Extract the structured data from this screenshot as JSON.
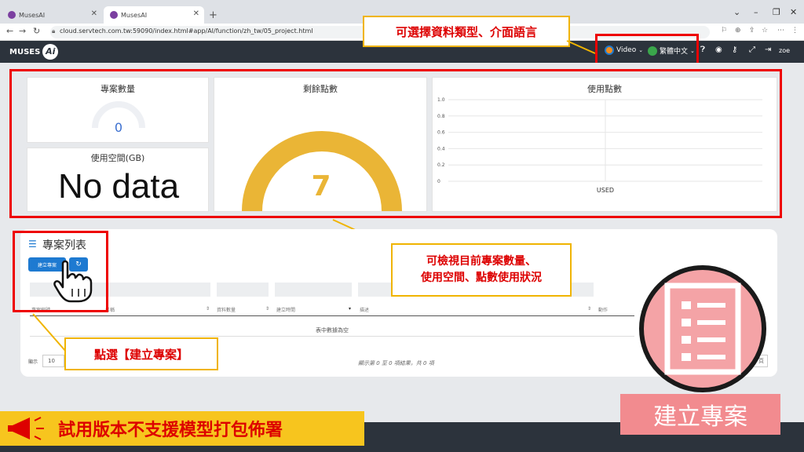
{
  "browser": {
    "tabs": [
      {
        "title": "MusesAI",
        "active": false
      },
      {
        "title": "MusesAI",
        "active": true
      }
    ],
    "url": "cloud.servtech.com.tw:59090/index.html#app/AI/function/zh_tw/05_project.html"
  },
  "header": {
    "logo_text": "MUSES",
    "logo_ai": "Ai",
    "video_label": "Video",
    "lang_label": "繁體中文",
    "user": "zoe"
  },
  "callouts": {
    "data_type_lang": "可選擇資料類型、介面語言",
    "view_stats_line1": "可檢視目前專案數量、",
    "view_stats_line2": "使用空間、點數使用狀況",
    "click_create": "點選【建立專案】"
  },
  "dashboard": {
    "project_count_title": "專案數量",
    "project_count_value": "0",
    "storage_title": "使用空間(GB)",
    "storage_value": "No data",
    "remaining_points_title": "剩餘點數",
    "remaining_points_value": "7",
    "used_points_title": "使用點數"
  },
  "chart_data": {
    "type": "bar",
    "title": "使用點數",
    "categories": [
      "USED"
    ],
    "values": [
      0
    ],
    "yticks": [
      "1.0",
      "0.8",
      "0.6",
      "0.4",
      "0.2",
      "0"
    ],
    "ylim": [
      0,
      1.0
    ]
  },
  "project_list": {
    "title": "專案列表",
    "create_button": "建立專案",
    "columns": [
      "專案編號",
      "名稱",
      "資料數量",
      "建立時間",
      "描述",
      "動作"
    ],
    "empty_text": "表中數據為空",
    "show_label": "顯示",
    "page_size": "10",
    "info_text": "顯示第 0 至 0 項結果，共 0 項",
    "next_page": "下頁"
  },
  "bottom": {
    "trial_notice": "試用版本不支援模型打包佈署",
    "create_project_banner": "建立專案"
  },
  "colors": {
    "header_bg": "#2c333c",
    "gauge_yellow": "#eab536",
    "accent_blue": "#1e7ad1",
    "annotation_red": "#e00000"
  }
}
